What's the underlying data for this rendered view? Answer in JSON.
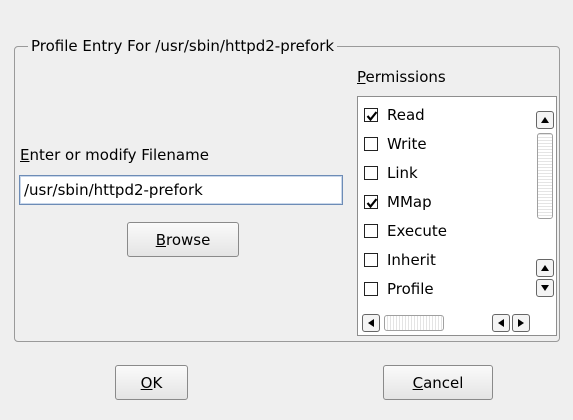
{
  "group": {
    "title": "Profile Entry For /usr/sbin/httpd2-prefork"
  },
  "filename": {
    "label_mnemonic": "E",
    "label_rest": "nter or modify Filename",
    "value": "/usr/sbin/httpd2-prefork"
  },
  "browse": {
    "mnemonic": "B",
    "rest": "rowse"
  },
  "permissions": {
    "label_mnemonic": "P",
    "label_rest": "ermissions",
    "items": [
      {
        "label": "Read",
        "checked": true
      },
      {
        "label": "Write",
        "checked": false
      },
      {
        "label": "Link",
        "checked": false
      },
      {
        "label": "MMap",
        "checked": true
      },
      {
        "label": "Execute",
        "checked": false
      },
      {
        "label": "Inherit",
        "checked": false
      },
      {
        "label": "Profile",
        "checked": false
      }
    ]
  },
  "dialog": {
    "ok_mnemonic": "O",
    "ok_rest": "K",
    "cancel_mnemonic": "C",
    "cancel_rest": "ancel"
  },
  "icons": {
    "check": "checkmark-icon",
    "scroll_up": "arrow-up-icon",
    "scroll_down": "arrow-down-icon",
    "scroll_left": "arrow-left-icon",
    "scroll_right": "arrow-right-icon"
  }
}
